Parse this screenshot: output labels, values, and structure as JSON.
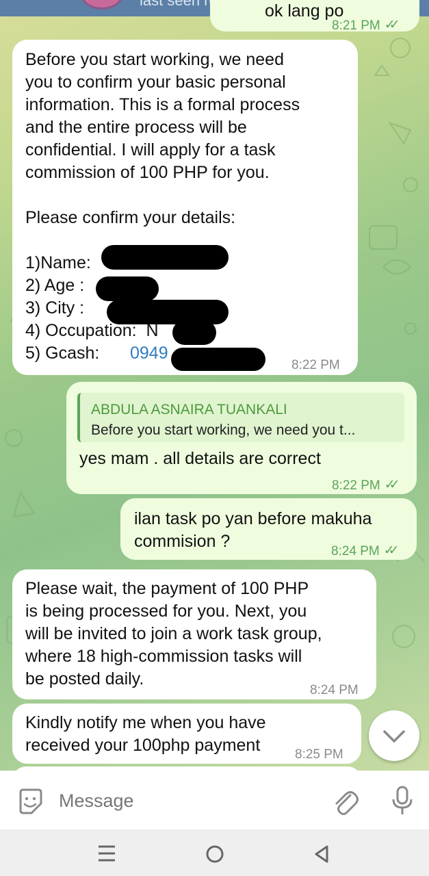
{
  "header": {
    "status": "last seen recently"
  },
  "messages": {
    "m0": {
      "text": "ok lang po",
      "time": "8:21 PM"
    },
    "m1": {
      "lines": [
        "Before you start working, we need",
        "you to confirm your basic personal",
        "information. This is a formal process",
        "and the entire process will be",
        "confidential. I will apply for a task",
        "commission of 100 PHP for you.",
        "",
        "Please confirm your details:",
        "",
        "1)Name:",
        "2) Age :",
        "3) City :",
        "4) Occupation:  N",
        "5) Gcash:"
      ],
      "gcash_partial": "0949",
      "time": "8:22 PM"
    },
    "m2": {
      "reply_name": "ABDULA ASNAIRA TUANKALI",
      "reply_text": "Before you start working, we need you t...",
      "text": "yes mam . all details are correct",
      "time": "8:22 PM"
    },
    "m3": {
      "lines": [
        "ilan task po yan before makuha",
        "commision ?"
      ],
      "time": "8:24 PM"
    },
    "m4": {
      "lines": [
        "Please wait, the payment of 100 PHP",
        "is being processed for you. Next, you",
        "will be invited to join a work task group,",
        "where 18 high-commission tasks will",
        "be posted daily."
      ],
      "time": "8:24 PM"
    },
    "m5": {
      "lines": [
        "Kindly notify me when you have",
        "received your 100php payment"
      ],
      "time": "8:25 PM"
    }
  },
  "input": {
    "placeholder": "Message"
  },
  "icons": {
    "sticker": "sticker-icon",
    "attach": "paperclip-icon",
    "mic": "microphone-icon",
    "scroll_down": "chevron-down-icon",
    "nav_menu": "menu-icon",
    "nav_home": "home-circle-icon",
    "nav_back": "back-triangle-icon"
  },
  "colors": {
    "accent": "#5ba35a",
    "incoming": "#ffffff",
    "outgoing": "#effdde",
    "link": "#2f7cc0"
  }
}
